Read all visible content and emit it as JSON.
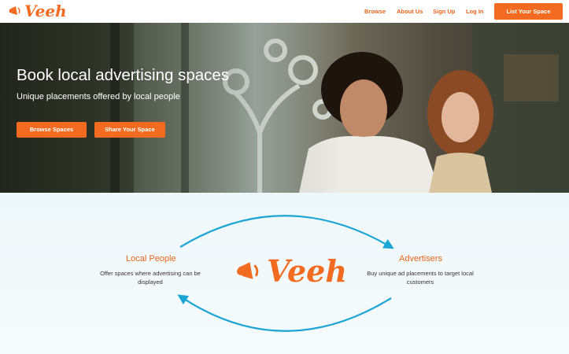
{
  "nav": {
    "logo_text": "Veeh",
    "links": [
      "Browse",
      "About Us",
      "Sign Up",
      "Log In"
    ],
    "cta_label": "List Your Space"
  },
  "hero": {
    "title": "Book local advertising spaces",
    "subtitle": "Unique placements offered by local people",
    "buttons": [
      "Browse Spaces",
      "Share Your Space"
    ]
  },
  "flow": {
    "left": {
      "title": "Local People",
      "desc": "Offer spaces where advertising can be displayed"
    },
    "right": {
      "title": "Advertisers",
      "desc": "Buy unique ad placements to target local customers"
    },
    "center_logo_text": "Veeh",
    "arrow_color": "#1aa5d4"
  },
  "colors": {
    "brand": "#f26b21",
    "white": "#ffffff"
  },
  "icons": {
    "logo": "megaphone-icon"
  }
}
